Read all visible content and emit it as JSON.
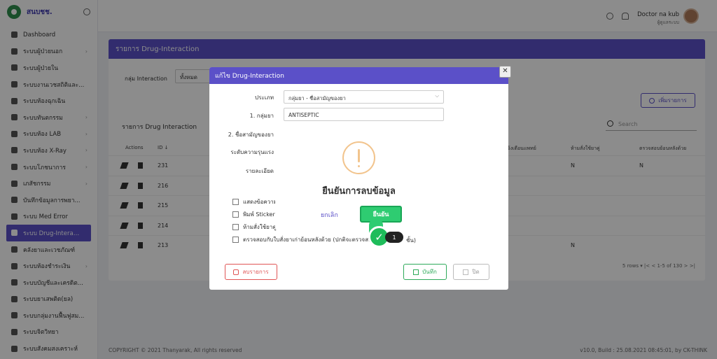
{
  "brand": {
    "name": "สนบชช."
  },
  "sidebar": {
    "items": [
      {
        "label": "Dashboard",
        "chevron": false
      },
      {
        "label": "ระบบผู้ป่วยนอก",
        "chevron": true
      },
      {
        "label": "ระบบผู้ป่วยใน",
        "chevron": false
      },
      {
        "label": "ระบบงานเวชสถิติและ...",
        "chevron": false
      },
      {
        "label": "ระบบห้องฉุกเฉิน",
        "chevron": false
      },
      {
        "label": "ระบบทันตกรรม",
        "chevron": true
      },
      {
        "label": "ระบบห้อง LAB",
        "chevron": true
      },
      {
        "label": "ระบบห้อง X-Ray",
        "chevron": true
      },
      {
        "label": "ระบบโภชนาการ",
        "chevron": true
      },
      {
        "label": "เภสัชกรรม",
        "chevron": true
      },
      {
        "label": "บันทึกข้อมูลการพยา...",
        "chevron": false
      },
      {
        "label": "ระบบ Med Error",
        "chevron": false
      },
      {
        "label": "ระบบ Drug-Interac...",
        "chevron": false,
        "active": true
      },
      {
        "label": "คลังยาและเวชภัณฑ์",
        "chevron": false
      },
      {
        "label": "ระบบห้องชำระเงิน",
        "chevron": true
      },
      {
        "label": "ระบบบัญชีและเครดิต...",
        "chevron": false
      },
      {
        "label": "ระบบยาเสพติด(ยล)",
        "chevron": false
      },
      {
        "label": "ระบบกลุ่มงานฟื้นฟูสม...",
        "chevron": false
      },
      {
        "label": "ระบบจิตวิทยา",
        "chevron": false
      },
      {
        "label": "ระบบสังคมสงเคราะห์",
        "chevron": false
      }
    ]
  },
  "topbar": {
    "user_name": "Doctor na kub",
    "user_role": "ผู้ดูแลระบบ"
  },
  "main": {
    "header": "รายการ Drug-Interaction",
    "filter_label": "กลุ่ม Interaction",
    "filter_value": "ทั้งหมด",
    "add_button": "เพิ่มรายการ",
    "list_title": "รายการ Drug Interaction",
    "search_placeholder": "Search",
    "columns": {
      "actions": "Actions",
      "id": "ID ↓",
      "notify_doctor": "แจ้งเตือนแพทย์",
      "forbid_use": "ห้ามสั่งใช้ยาคู่",
      "check_prev": "ตรวจสอบย้อนหลังด้วย"
    },
    "rows": [
      {
        "id": "231",
        "n1": "N",
        "n2": "N"
      },
      {
        "id": "216",
        "n1": "",
        "n2": ""
      },
      {
        "id": "215",
        "n1": "",
        "n2": ""
      },
      {
        "id": "214",
        "n1": "",
        "n2": ""
      },
      {
        "id": "213",
        "n1": "N",
        "n2": ""
      }
    ],
    "pager": "5 rows ▾     |<   <   1-5 of 130   >   >|"
  },
  "footer": {
    "left": "COPYRIGHT © 2021 Thanyarak, All rights reserved",
    "right": "v10.0, Build : 25.08.2021 08:45:01, by CK-THINK"
  },
  "edit_modal": {
    "title": "แก้ไข Drug-Interaction",
    "type_label": "ประเภท",
    "type_value": "กลุ่มยา - ชื่อสามัญของยา",
    "group_label": "1. กลุ่มยา",
    "group_value": "ANTISEPTIC",
    "generic_label": "2. ชื่อสามัญของยา",
    "severity_label": "ระดับความรุนแรง",
    "detail_label": "รายละเอียด",
    "cb_show": "แสดงข้อความแ",
    "cb_sticker": "พิมพ์ Sticker",
    "cb_forbid": "ห้ามสั่งใช้ยาคู่กั",
    "cb_check": "ตรวจสอบกับใบสั่งยาเก่าย้อนหลังด้วย (ปกติจะตรวจสอบแ",
    "cb_check_tail": "ชั้น)",
    "delete_button": "ลบรายการ",
    "save_button": "บันทึก",
    "close_button": "ปิด",
    "close_x": "✕"
  },
  "confirm": {
    "title": "ยืนยันการลบข้อมูล",
    "cancel": "ยกเลิก",
    "confirm": "ยืนยัน",
    "step": "1",
    "check": "✓"
  }
}
